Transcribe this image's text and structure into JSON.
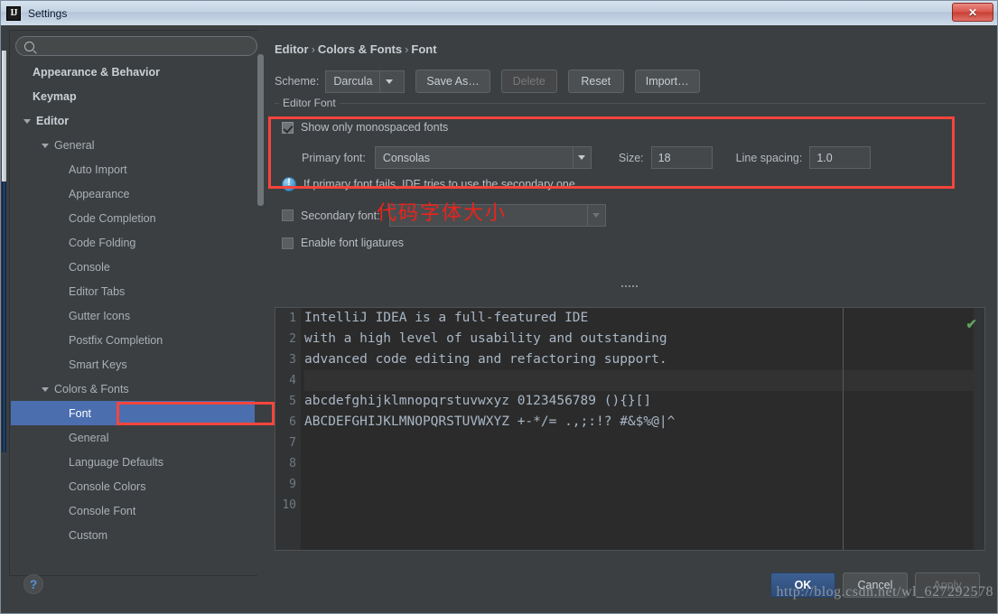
{
  "window": {
    "title": "Settings",
    "app_icon": "IJ",
    "close_label": "✕"
  },
  "sidebar": {
    "search": {
      "value": "",
      "placeholder": "",
      "icon": "search-icon"
    },
    "items": [
      {
        "label": "Appearance & Behavior",
        "indent": 0,
        "bold": true,
        "arrow": "none",
        "selected": false
      },
      {
        "label": "Keymap",
        "indent": 0,
        "bold": true,
        "arrow": "none",
        "selected": false
      },
      {
        "label": "Editor",
        "indent": 0,
        "bold": true,
        "arrow": "expanded",
        "selected": false
      },
      {
        "label": "General",
        "indent": 1,
        "bold": false,
        "arrow": "expanded",
        "selected": false
      },
      {
        "label": "Auto Import",
        "indent": 2,
        "bold": false,
        "arrow": "none",
        "selected": false
      },
      {
        "label": "Appearance",
        "indent": 2,
        "bold": false,
        "arrow": "none",
        "selected": false
      },
      {
        "label": "Code Completion",
        "indent": 2,
        "bold": false,
        "arrow": "none",
        "selected": false
      },
      {
        "label": "Code Folding",
        "indent": 2,
        "bold": false,
        "arrow": "none",
        "selected": false
      },
      {
        "label": "Console",
        "indent": 2,
        "bold": false,
        "arrow": "none",
        "selected": false
      },
      {
        "label": "Editor Tabs",
        "indent": 2,
        "bold": false,
        "arrow": "none",
        "selected": false
      },
      {
        "label": "Gutter Icons",
        "indent": 2,
        "bold": false,
        "arrow": "none",
        "selected": false
      },
      {
        "label": "Postfix Completion",
        "indent": 2,
        "bold": false,
        "arrow": "none",
        "selected": false
      },
      {
        "label": "Smart Keys",
        "indent": 2,
        "bold": false,
        "arrow": "none",
        "selected": false
      },
      {
        "label": "Colors & Fonts",
        "indent": 1,
        "bold": false,
        "arrow": "expanded",
        "selected": false
      },
      {
        "label": "Font",
        "indent": 2,
        "bold": false,
        "arrow": "none",
        "selected": true
      },
      {
        "label": "General",
        "indent": 2,
        "bold": false,
        "arrow": "none",
        "selected": false
      },
      {
        "label": "Language Defaults",
        "indent": 2,
        "bold": false,
        "arrow": "none",
        "selected": false
      },
      {
        "label": "Console Colors",
        "indent": 2,
        "bold": false,
        "arrow": "none",
        "selected": false
      },
      {
        "label": "Console Font",
        "indent": 2,
        "bold": false,
        "arrow": "none",
        "selected": false
      },
      {
        "label": "Custom",
        "indent": 2,
        "bold": false,
        "arrow": "none",
        "selected": false
      }
    ]
  },
  "pane": {
    "breadcrumb": {
      "part1": "Editor",
      "sep1": "›",
      "part2": "Colors & Fonts",
      "sep2": "›",
      "part3": "Font"
    },
    "scheme": {
      "label": "Scheme:",
      "value": "Darcula",
      "buttons": [
        {
          "label": "Save As…",
          "disabled": false
        },
        {
          "label": "Delete",
          "disabled": true
        },
        {
          "label": "Reset",
          "disabled": false
        },
        {
          "label": "Import…",
          "disabled": false
        }
      ]
    },
    "editor_font": {
      "group_title": "Editor Font",
      "show_monospaced": {
        "label": "Show only monospaced fonts",
        "checked": true
      },
      "primary_font": {
        "label": "Primary font:",
        "value": "Consolas"
      },
      "size": {
        "label": "Size:",
        "value": "18"
      },
      "line_spacing": {
        "label": "Line spacing:",
        "value": "1.0"
      },
      "hint": "If primary font fails, IDE tries to use the secondary one",
      "secondary_font": {
        "label": "Secondary font:",
        "value": "",
        "checked": false
      },
      "ligatures": {
        "label": "Enable font ligatures",
        "checked": false
      }
    },
    "annotation_cn": "代码字体大小",
    "preview": {
      "line_numbers": [
        "1",
        "2",
        "3",
        "4",
        "5",
        "6",
        "7",
        "8",
        "9",
        "10"
      ],
      "lines": [
        "IntelliJ IDEA is a full-featured IDE",
        "with a high level of usability and outstanding",
        "advanced code editing and refactoring support.",
        "",
        "abcdefghijklmnopqrstuvwxyz 0123456789 (){}[]",
        "ABCDEFGHIJKLMNOPQRSTUVWXYZ +-*/= .,;:!? #&$%@|^",
        "",
        "",
        "",
        ""
      ],
      "caret_line_index": 3,
      "inspection_status": "✔"
    }
  },
  "footer": {
    "help": "?",
    "ok": "OK",
    "cancel": "Cancel",
    "apply": "Apply",
    "watermark": "http://blog.csdn.net/wl_627292578"
  },
  "colors": {
    "accent_selection": "#4b6eaf",
    "annotation_red": "#f5453c",
    "dialog_bg": "#3c3f41",
    "editor_bg": "#2b2b2b",
    "ok_button": "#3c5f93",
    "inspection_green": "#61a15c"
  }
}
